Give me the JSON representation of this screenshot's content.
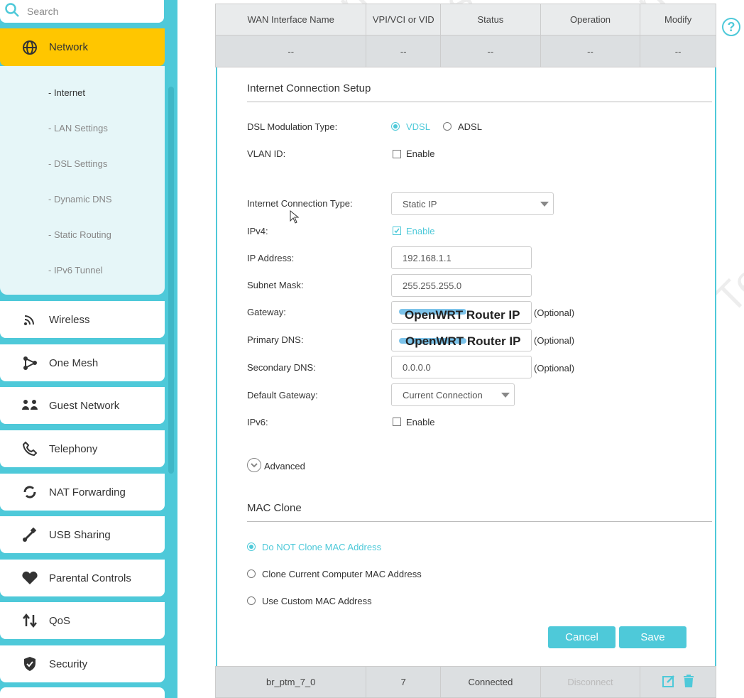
{
  "search": {
    "placeholder": "Search"
  },
  "sidebar": {
    "active": "Network",
    "submenu": [
      "- Internet",
      "- LAN Settings",
      "- DSL Settings",
      "- Dynamic DNS",
      "- Static Routing",
      "- IPv6 Tunnel"
    ],
    "items": [
      "Wireless",
      "One Mesh",
      "Guest Network",
      "Telephony",
      "NAT Forwarding",
      "USB Sharing",
      "Parental Controls",
      "QoS",
      "Security"
    ]
  },
  "table": {
    "headers": [
      "WAN Interface Name",
      "VPI/VCI or VID",
      "Status",
      "Operation",
      "Modify"
    ],
    "placeholder_row": [
      "--",
      "--",
      "--",
      "--",
      "--"
    ],
    "footer_row": [
      "br_ptm_7_0",
      "7",
      "Connected",
      "Disconnect"
    ]
  },
  "form": {
    "section_title": "Internet Connection Setup",
    "dsl_label": "DSL Modulation Type:",
    "dsl_options": [
      "VDSL",
      "ADSL"
    ],
    "vlan_label": "VLAN ID:",
    "enable": "Enable",
    "conn_type_label": "Internet Connection Type:",
    "conn_type_value": "Static IP",
    "ipv4_label": "IPv4:",
    "ip_label": "IP Address:",
    "ip_value": "192.168.1.1",
    "mask_label": "Subnet Mask:",
    "mask_value": "255.255.255.0",
    "gateway_label": "Gateway:",
    "gateway_value": "OpenWRT Router IP",
    "pdns_label": "Primary DNS:",
    "pdns_value": "OpenWRT Router IP",
    "sdns_label": "Secondary DNS:",
    "sdns_value": "0.0.0.0",
    "optional": "(Optional)",
    "defgw_label": "Default Gateway:",
    "defgw_value": "Current Connection",
    "ipv6_label": "IPv6:",
    "advanced": "Advanced"
  },
  "mac": {
    "title": "MAC Clone",
    "options": [
      "Do NOT Clone MAC Address",
      "Clone Current Computer MAC Address",
      "Use Custom MAC Address"
    ]
  },
  "buttons": {
    "cancel": "Cancel",
    "save": "Save"
  },
  "watermark": {
    "a": "Confidential",
    "b": "Only For Test"
  },
  "colors": {
    "accent": "#4ec9d9",
    "active": "#ffc600"
  }
}
